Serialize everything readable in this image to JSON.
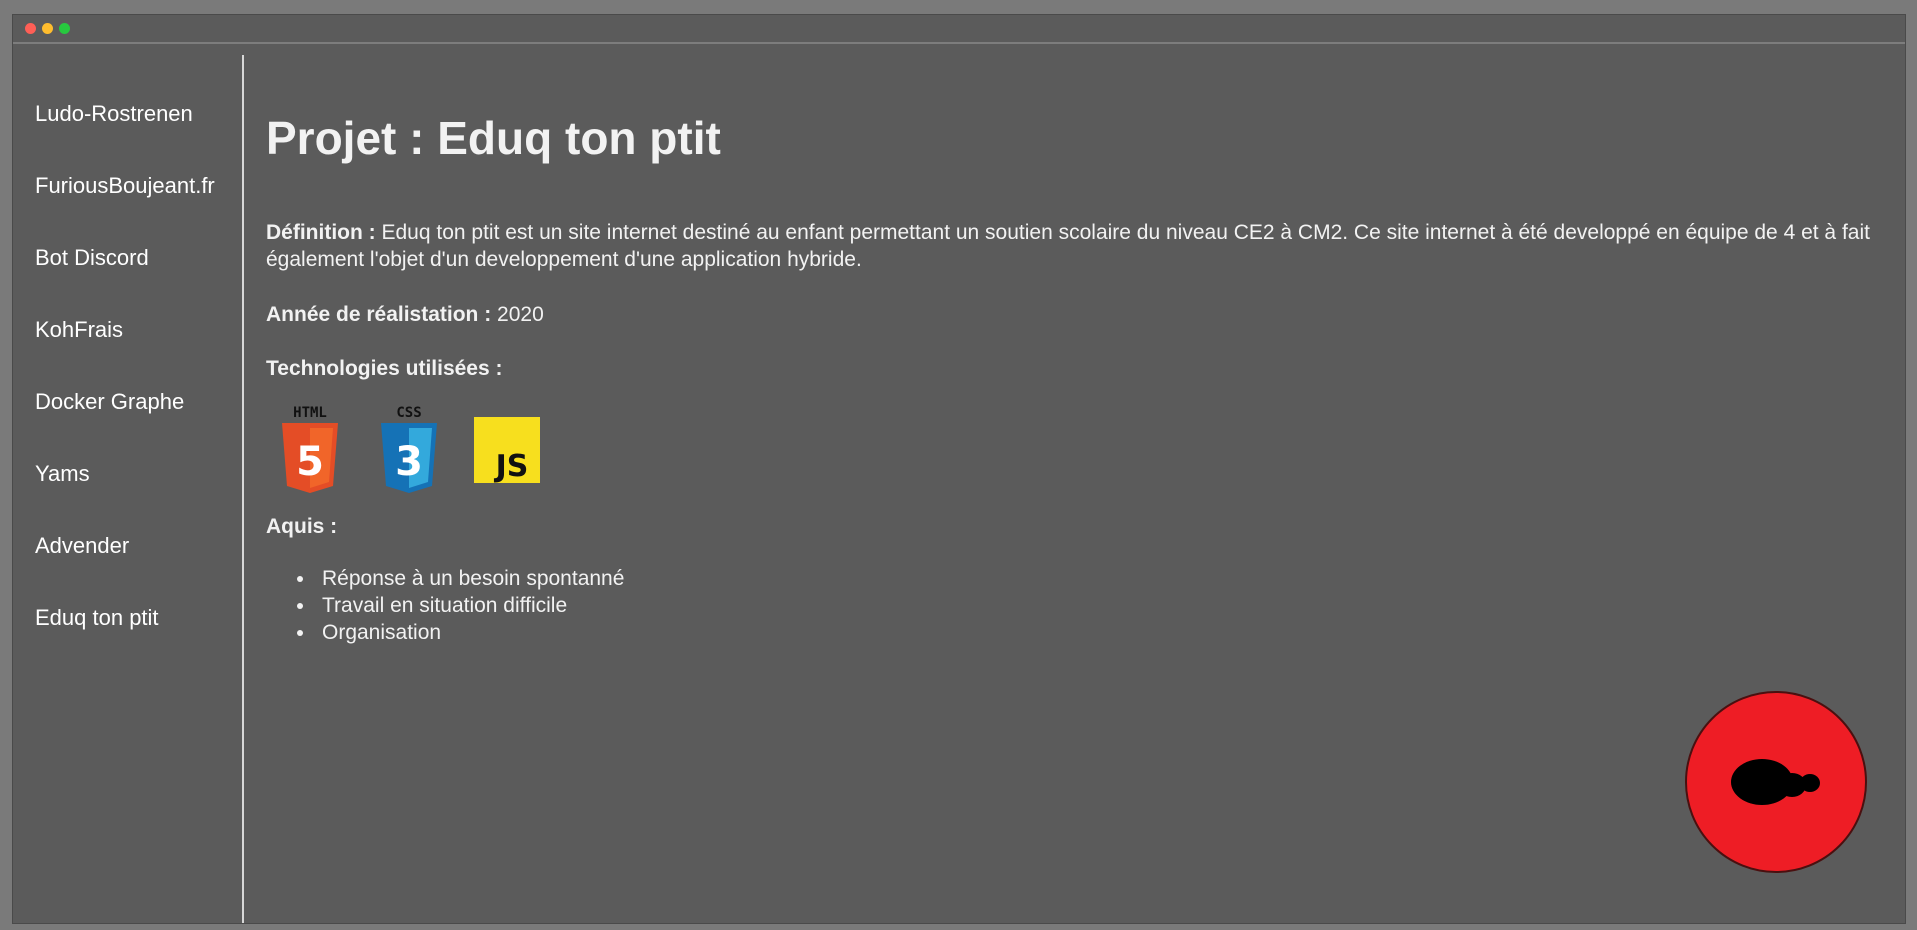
{
  "sidebar": {
    "items": [
      {
        "label": "Ludo-Rostrenen"
      },
      {
        "label": "FuriousBoujeant.fr"
      },
      {
        "label": "Bot Discord"
      },
      {
        "label": "KohFrais"
      },
      {
        "label": "Docker Graphe"
      },
      {
        "label": "Yams"
      },
      {
        "label": "Advender"
      },
      {
        "label": "Eduq ton ptit"
      }
    ]
  },
  "main": {
    "title": "Projet : Eduq ton ptit",
    "definition_label": "Définition :",
    "definition_text": " Eduq ton ptit est un site internet destiné au enfant permettant un soutien scolaire du niveau CE2 à CM2. Ce site internet à été developpé en équipe de 4 et à fait également l'objet d'un developpement d'une application hybride.",
    "year_label": "Année de réalistation :",
    "year_value": " 2020",
    "technologies_label": "Technologies utilisées :",
    "technologies": [
      {
        "name": "HTML",
        "badge": "5",
        "icon": "html5-icon",
        "color": "#e44d26",
        "color_light": "#f16529"
      },
      {
        "name": "CSS",
        "badge": "3",
        "icon": "css3-icon",
        "color": "#1572b6",
        "color_light": "#33a9dc"
      },
      {
        "name": "JS",
        "icon": "javascript-icon",
        "color": "#f7df1e"
      }
    ],
    "acquis_label": "Aquis :",
    "acquis": [
      "Réponse à un besoin spontanné",
      "Travail en situation difficile",
      "Organisation"
    ]
  },
  "colors": {
    "window_bg": "#5b5b5b",
    "page_bg": "#7a7a7a",
    "logo_red": "#ee1d25"
  },
  "logo": {
    "icon": "brand-logo-icon"
  }
}
